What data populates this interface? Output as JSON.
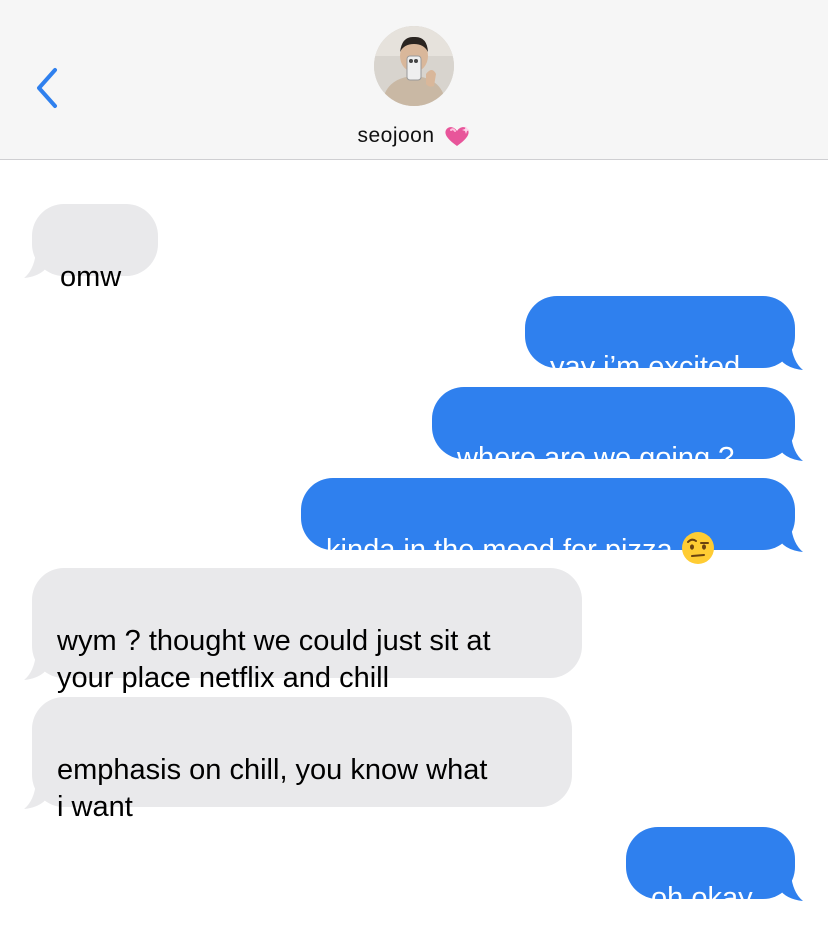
{
  "header": {
    "back_icon": "chevron-left-icon",
    "contact_name": "seojoon",
    "name_emoji": "sparkling-heart-icon",
    "accent_color": "#2f80ee"
  },
  "messages": [
    {
      "from": "them",
      "text": "omw"
    },
    {
      "from": "me",
      "text": "yay i’m excited"
    },
    {
      "from": "me",
      "text": "where are we going ?"
    },
    {
      "from": "me",
      "text": "kinda in the mood for pizza",
      "emoji": "raised-eyebrow-face-icon"
    },
    {
      "from": "them",
      "text": "wym ? thought we could just sit at\nyour place netflix and chill"
    },
    {
      "from": "them",
      "text": "emphasis on chill, you know what\ni want"
    },
    {
      "from": "me",
      "text": "oh okay"
    }
  ],
  "colors": {
    "outgoing_bubble": "#2f80ee",
    "incoming_bubble": "#e9e9eb",
    "header_bg": "#f6f6f6"
  }
}
